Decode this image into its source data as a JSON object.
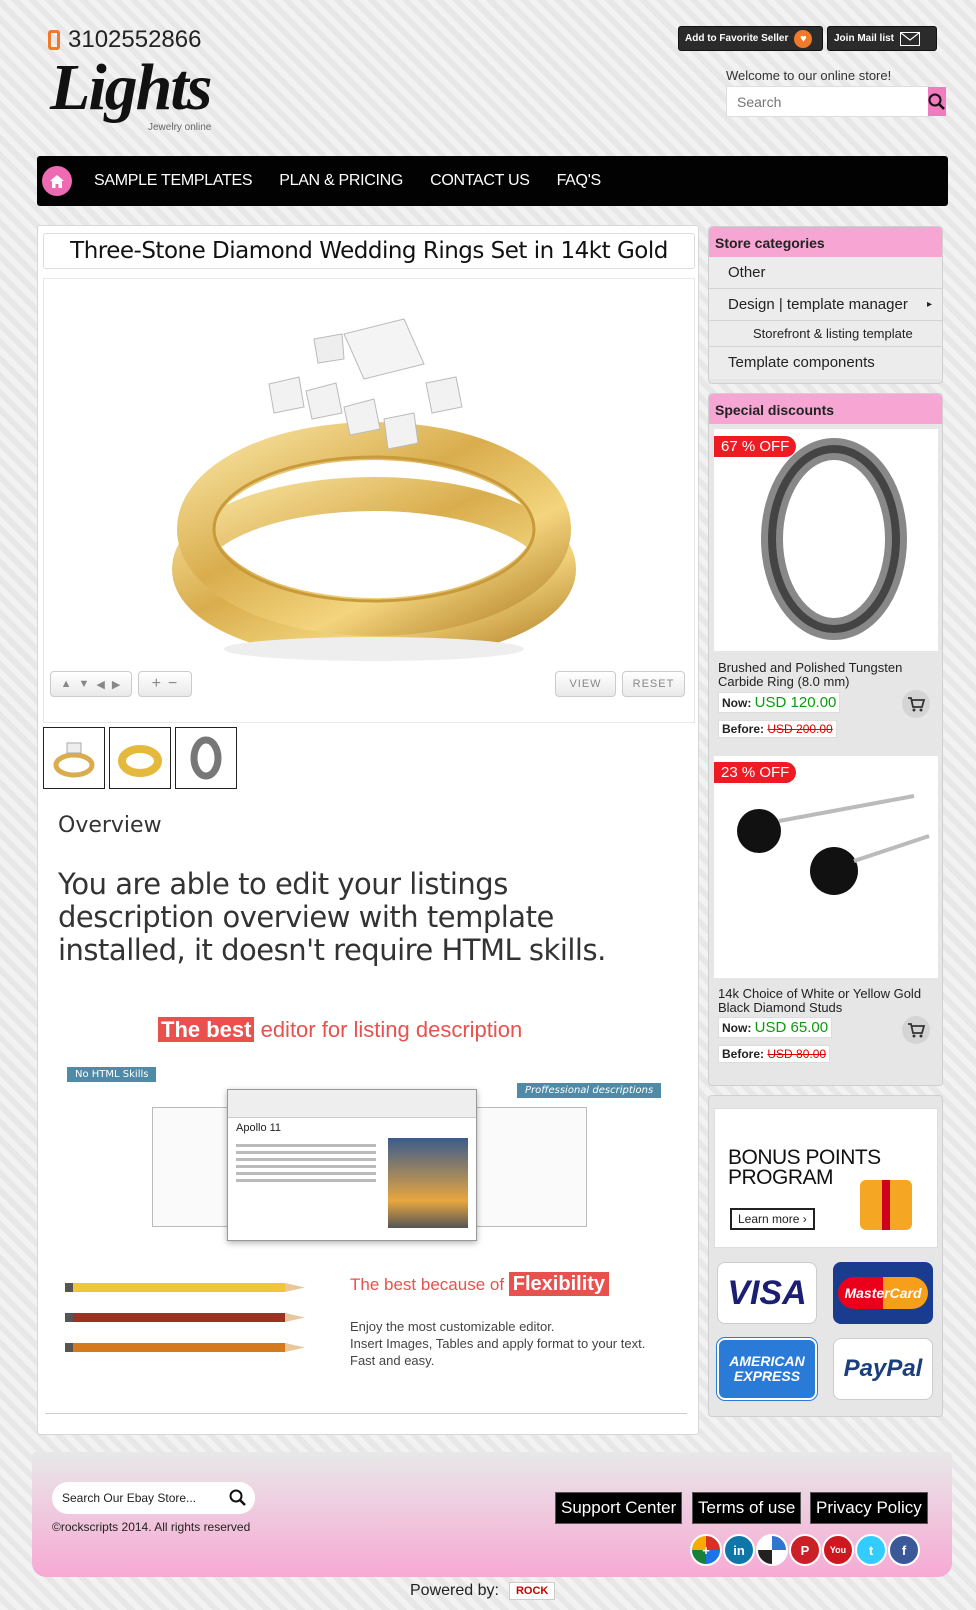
{
  "header": {
    "phone": "3102552866",
    "logo": "Lights",
    "logo_tagline": "Jewelry online",
    "favorite_label": "Add to Favorite Seller",
    "mail_label": "Join Mail list",
    "welcome": "Welcome to our online store!",
    "search_placeholder": "Search"
  },
  "nav": {
    "items": [
      "SAMPLE TEMPLATES",
      "PLAN & PRICING",
      "CONTACT US",
      "FAQ'S"
    ]
  },
  "listing": {
    "title": "Three-Stone Diamond Wedding Rings Set in 14kt Gold",
    "view_label": "VIEW",
    "reset_label": "RESET",
    "overview_heading": "Overview",
    "overview_text": "You are able to edit your listings description overview with template installed, it doesn't require HTML skills.",
    "best_tag": "The best",
    "best_rest": " editor for listing description",
    "no_html": "No HTML Skills",
    "pro_desc": "Proffessional descriptions",
    "editor_doc_title": "Apollo 11",
    "flex_prefix": "The best because of ",
    "flex_tag": "Flexibility",
    "enjoy_lines": [
      "Enjoy the most customizable editor.",
      "Insert Images, Tables and apply format to your text.",
      "Fast and easy."
    ]
  },
  "sidebar": {
    "categories_heading": "Store categories",
    "categories": [
      "Other",
      "Design | template manager",
      "Storefront & listing template",
      "Template components"
    ],
    "discounts_heading": "Special discounts",
    "products": [
      {
        "off": "67 % OFF",
        "name": "Brushed and Polished Tungsten Carbide Ring (8.0 mm)",
        "now_label": "Now:",
        "now": "USD 120.00",
        "before_label": "Before:",
        "before": "USD 200.00"
      },
      {
        "off": "23 % OFF",
        "name": "14k Choice of White or Yellow Gold Black Diamond Studs",
        "now_label": "Now:",
        "now": "USD 65.00",
        "before_label": "Before:",
        "before": "USD 80.00"
      }
    ],
    "bonus_line1": "BONUS POINTS",
    "bonus_line2": "PROGRAM",
    "learn_more": "Learn more ›",
    "payments": [
      "VISA",
      "MasterCard",
      "AMERICAN EXPRESS",
      "PayPal"
    ]
  },
  "footer": {
    "search_placeholder": "Search Our Ebay Store...",
    "copyright": "©rockscripts 2014. All rights reserved",
    "links": [
      "Support Center",
      "Terms of use",
      "Privacy Policy"
    ],
    "social_icons": [
      "google-plus-icon",
      "linkedin-icon",
      "delicious-icon",
      "pinterest-icon",
      "youtube-icon",
      "twitter-icon",
      "facebook-icon"
    ],
    "powered_by": "Powered by:",
    "powered_brand": "ROCK"
  },
  "colors": {
    "accent_pink": "#f07bbf",
    "nav_bg": "#020202",
    "sale_red": "#ee1b24",
    "price_green": "#0a9b0a",
    "highlight_red": "#e9514e"
  }
}
